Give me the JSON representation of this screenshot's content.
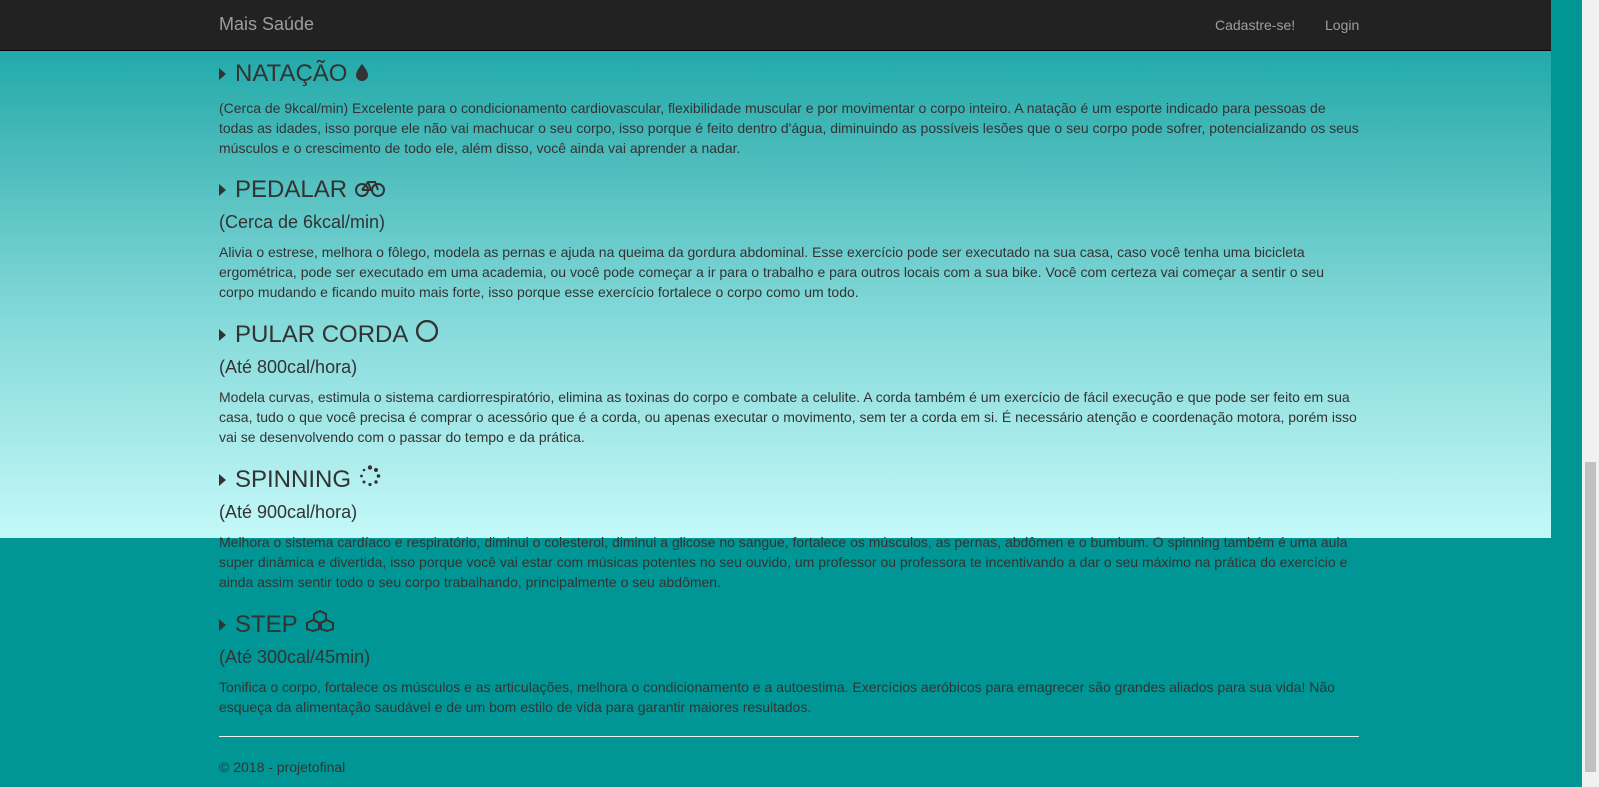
{
  "navbar": {
    "brand": "Mais Saúde",
    "links": [
      "Cadastre-se!",
      "Login"
    ]
  },
  "sections": [
    {
      "title": "NATAÇÃO",
      "icon": "water-drop-icon",
      "subtitle": "",
      "text": "(Cerca de 9kcal/min) Excelente para o condicionamento cardiovascular, flexibilidade muscular e por movimentar o corpo inteiro. A natação é um esporte indicado para pessoas de todas as idades, isso porque ele não vai machucar o seu corpo, isso porque é feito dentro d'água, diminuindo as possíveis lesões que o seu corpo pode sofrer, potencializando os seus músculos e o crescimento de todo ele, além disso, você ainda vai aprender a nadar."
    },
    {
      "title": "PEDALAR",
      "icon": "bicycle-icon",
      "subtitle": "(Cerca de 6kcal/min)",
      "text": "Alivia o estrese, melhora o fôlego, modela as pernas e ajuda na queima da gordura abdominal. Esse exercício pode ser executado na sua casa, caso você tenha uma bicicleta ergométrica, pode ser executado em uma academia, ou você pode começar a ir para o trabalho e para outros locais com a sua bike. Você com certeza vai começar a sentir o seu corpo mudando e ficando muito mais forte, isso porque esse exercício fortalece o corpo como um todo."
    },
    {
      "title": "PULAR CORDA",
      "icon": "refresh-loop-icon",
      "subtitle": "(Até 800cal/hora)",
      "text": "Modela curvas, estimula o sistema cardiorrespiratório, elimina as toxinas do corpo e combate a celulite. A corda também é um exercício de fácil execução e que pode ser feito em sua casa, tudo o que você precisa é comprar o acessório que é a corda, ou apenas executar o movimento, sem ter a corda em si. É necessário atenção e coordenação motora, porém isso vai se desenvolvendo com o passar do tempo e da prática."
    },
    {
      "title": "SPINNING",
      "icon": "spinner-icon",
      "subtitle": "(Até 900cal/hora)",
      "text": "Melhora o sistema cardíaco e respiratório, diminui o colesterol, diminui a glicose no sangue, fortalece os músculos, as pernas, abdômen e o bumbum. O spinning também é uma aula super dinâmica e divertida, isso porque você vai estar com músicas potentes no seu ouvido, um professor ou professora te incentivando a dar o seu máximo na prática do exercício e ainda assim sentir todo o seu corpo trabalhando, principalmente o seu abdômen."
    },
    {
      "title": "STEP",
      "icon": "cubes-icon",
      "subtitle": "(Até 300cal/45min)",
      "text": "Tonifica o corpo, fortalece os músculos e as articulações, melhora o condicionamento e a autoestima. Exercícios aeróbicos para emagrecer são grandes aliados para sua vida! Não esqueça da alimentação saudável e de um bom estilo de vida para garantir maiores resultados."
    }
  ],
  "footer": {
    "text": "© 2018 - projetofinal"
  },
  "colors": {
    "navbar": "#222222",
    "teal": "#009696",
    "text": "#333333"
  }
}
